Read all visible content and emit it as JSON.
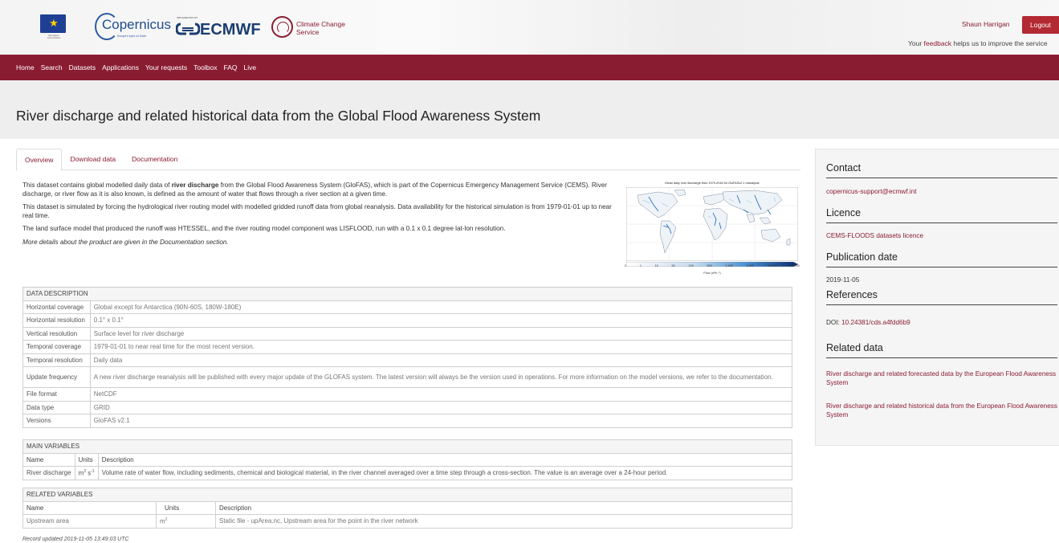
{
  "header": {
    "eu_caption": "European Commission",
    "copernicus_logo": "Copernicus",
    "copernicus_tagline": "Europe's eyes on Earth",
    "ecmwf_small": "IMPLEMENTED BY",
    "ecmwf_logo": "ECMWF",
    "c3s_line1": "Climate Change",
    "c3s_line2": "Service",
    "user_name": "Shaun Harrigan",
    "logout_label": "Logout",
    "feedback_pre": "Your ",
    "feedback_link": "feedback",
    "feedback_post": " helps us to improve the service"
  },
  "nav": {
    "items": [
      "Home",
      "Search",
      "Datasets",
      "Applications",
      "Your requests",
      "Toolbox",
      "FAQ",
      "Live"
    ]
  },
  "page": {
    "title": "River discharge and related historical data from the Global Flood Awareness System"
  },
  "tabs": [
    {
      "label": "Overview",
      "active": true
    },
    {
      "label": "Download data",
      "active": false
    },
    {
      "label": "Documentation",
      "active": false
    }
  ],
  "overview": {
    "p1_a": "This dataset contains global modelled daily data of ",
    "p1_bold": "river discharge",
    "p1_b": " from the Global Flood Awareness System (GloFAS), which is part of the Copernicus Emergency Management Service (CEMS). River discharge, or river flow as it is also known, is defined as the amount of water that flows through a river section at a given time.",
    "p2": "This dataset is simulated by forcing the hydrological river routing model with modelled gridded runoff data from global reanalysis. Data availability for the historical simulation is from 1979-01-01 up to near real time.",
    "p3": "The land surface model that produced the runoff was HTESSEL, and the river routing model component was LISFLOOD, run with a 0.1 x 0.1 degree lat-lon resolution.",
    "p4": "More details about the product are given in the Documentation section."
  },
  "map": {
    "title": "Mean daily river discharge from 1979-2018 for GloFASv2.1 reanalysis",
    "ticks": [
      "0",
      "1",
      "10",
      "50",
      "100",
      "500",
      "1,000",
      "5,000",
      "10,000",
      "50,000"
    ],
    "axis_label": "Flow (m³s⁻¹)"
  },
  "data_description": {
    "header": "DATA DESCRIPTION",
    "rows": [
      {
        "label": "Horizontal coverage",
        "value": "Global except for Antarctica (90N-60S, 180W-180E)"
      },
      {
        "label": "Horizontal resolution",
        "value": "0.1° x 0.1°"
      },
      {
        "label": "Vertical resolution",
        "value": "Surface level for river discharge"
      },
      {
        "label": "Temporal coverage",
        "value": "1979-01-01 to near real time for the most recent version."
      },
      {
        "label": "Temporal resolution",
        "value": "Daily data"
      },
      {
        "label": "Update frequency",
        "value": "A new river discharge reanalysis will be published with every major update of the GLOFAS system. The latest version will always be the version used in operations. For more information on the model versions, we refer to the documentation."
      },
      {
        "label": "File format",
        "value": "NetCDF"
      },
      {
        "label": "Data type",
        "value": "GRID"
      },
      {
        "label": "Versions",
        "value": "GloFAS v2.1"
      }
    ]
  },
  "main_variables": {
    "header": "MAIN VARIABLES",
    "columns": [
      "Name",
      "Units",
      "Description"
    ],
    "rows": [
      {
        "name": "River discharge",
        "units_base": "m",
        "units_sup1": "3",
        "units_mid": " s",
        "units_sup2": "-1",
        "description": "Volume rate of water flow, including sediments, chemical and biological material, in the river channel averaged over a time step through a cross-section. The value is an average over a 24-hour period."
      }
    ]
  },
  "related_variables": {
    "header": "RELATED VARIABLES",
    "columns": [
      "Name",
      "Units",
      "Description"
    ],
    "rows": [
      {
        "name": "Upstream area",
        "units_base": "m",
        "units_sup": "2",
        "description": "Static file - upArea.nc, Upstream area for the point in the river network"
      }
    ]
  },
  "record_updated": "Record updated 2019-11-05 13:49:03 UTC",
  "sidebar": {
    "contact_heading": "Contact",
    "contact_value": "copernicus-support@ecmwf.int",
    "licence_heading": "Licence",
    "licence_value": "CEMS-FLOODS datasets licence",
    "publication_heading": "Publication date",
    "publication_value": "2019-11-05",
    "references_heading": "References",
    "references_prefix": "DOI: ",
    "references_doi": "10.24381/cds.a4fdd6b9",
    "related_heading": "Related data",
    "related_items": [
      "River discharge and related forecasted data by the European Flood Awareness System",
      "River discharge and related historical data from the European Flood Awareness System"
    ]
  },
  "colors": {
    "brand": "#8a1c32",
    "logout": "#b32a33",
    "title_band": "#eeeeee",
    "sidebar_bg": "#f5f5f5"
  }
}
